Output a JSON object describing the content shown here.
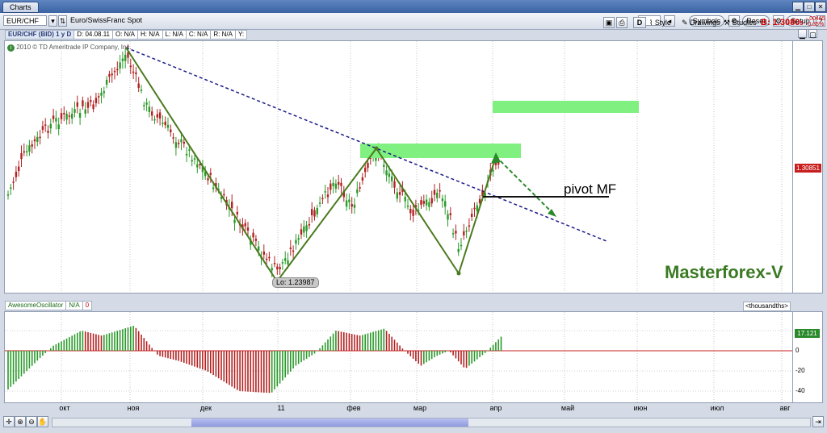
{
  "window": {
    "tab_label": "Charts"
  },
  "toolbar": {
    "symbol": "EUR/CHF",
    "description": "Euro/SwissFranc Spot",
    "symbols_label": "Symbols",
    "reset_label": "Reset",
    "setup_label": "Setup",
    "d_label": "D",
    "style_label": "Style",
    "drawings_label": "Drawings",
    "studies_label": "Studies",
    "bid_label": "B: 1.3080",
    "bid_suffix": "5",
    "change_abs": "-.00465",
    "change_pct": "-0.35%"
  },
  "infobar": {
    "symbol": "EUR/CHF (BID) 1 y D",
    "date": "D: 04.08.11",
    "open": "O: N/A",
    "high": "H: N/A",
    "low": "L: N/A",
    "close": "C: N/A",
    "range": "R: N/A",
    "y": "Y:"
  },
  "chart": {
    "copyright": "2010 © TD Ameritrade IP Company, Inc.",
    "low_label": "Lo: 1.23987",
    "pivot_label": "pivot MF",
    "watermark": "Masterforex-V",
    "price_tag": "1.30851"
  },
  "oscillator": {
    "name": "AwesomeOscillator",
    "value_na": "N/A",
    "zero_box": "0",
    "units": "<thousandths>",
    "value_tag": "17.121",
    "y_ticks": [
      "20",
      "0",
      "-20",
      "-40"
    ]
  },
  "x_axis": {
    "labels": [
      "окт",
      "ноя",
      "дек",
      "11",
      "фев",
      "мар",
      "апр",
      "май",
      "июн",
      "июл",
      "авг"
    ]
  },
  "colors": {
    "up": "#2a9a2a",
    "down": "#b22222",
    "zigzag": "#4a7a1e",
    "trend": "#1a1a8a",
    "zone": "#80f080",
    "watermark": "#3a7a22"
  },
  "chart_data": {
    "type": "candlestick",
    "x_labels": [
      "окт",
      "ноя",
      "дек",
      "11",
      "фев",
      "мар",
      "апр",
      "май",
      "июн",
      "июл",
      "авг"
    ],
    "annotations": [
      "Lo: 1.23987",
      "pivot MF",
      "Masterforex-V"
    ],
    "last_price": 1.30851,
    "oscillator_range": [
      -40,
      20
    ]
  }
}
